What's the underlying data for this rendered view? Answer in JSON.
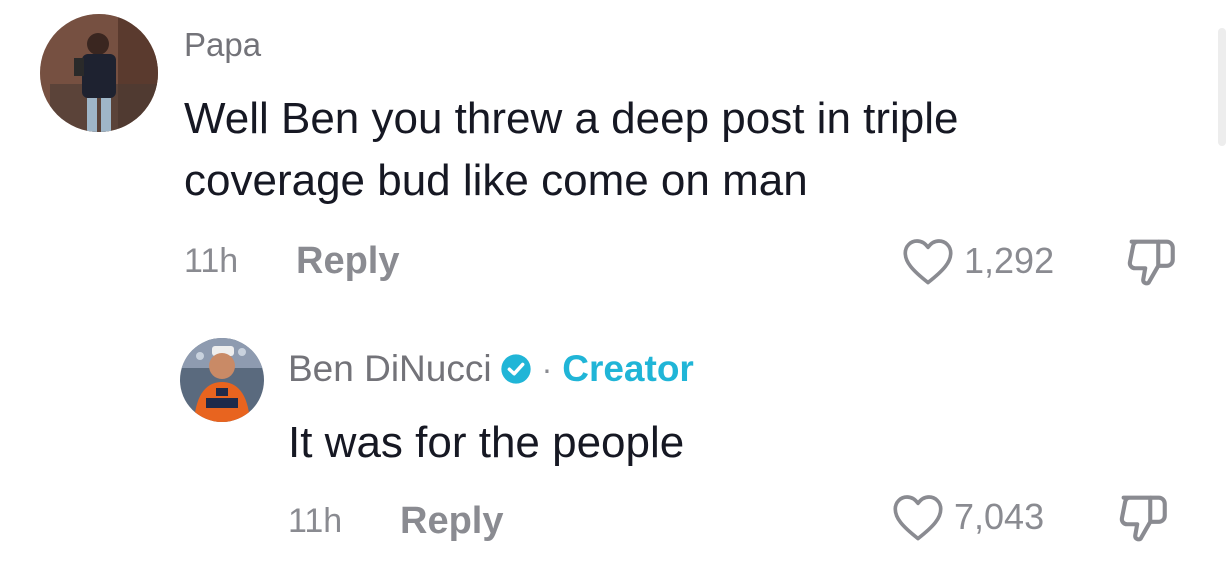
{
  "comments": [
    {
      "username": "Papa",
      "text": "Well Ben you threw a deep post in triple coverage bud like come on man",
      "time": "11h",
      "reply_label": "Reply",
      "likes": "1,292"
    }
  ],
  "replies": [
    {
      "username": "Ben DiNucci",
      "separator": "·",
      "badge": "Creator",
      "text": "It was for the people",
      "time": "11h",
      "reply_label": "Reply",
      "likes": "7,043"
    }
  ],
  "colors": {
    "creator_accent": "#20b5d7",
    "muted_text": "#8a8b91"
  }
}
